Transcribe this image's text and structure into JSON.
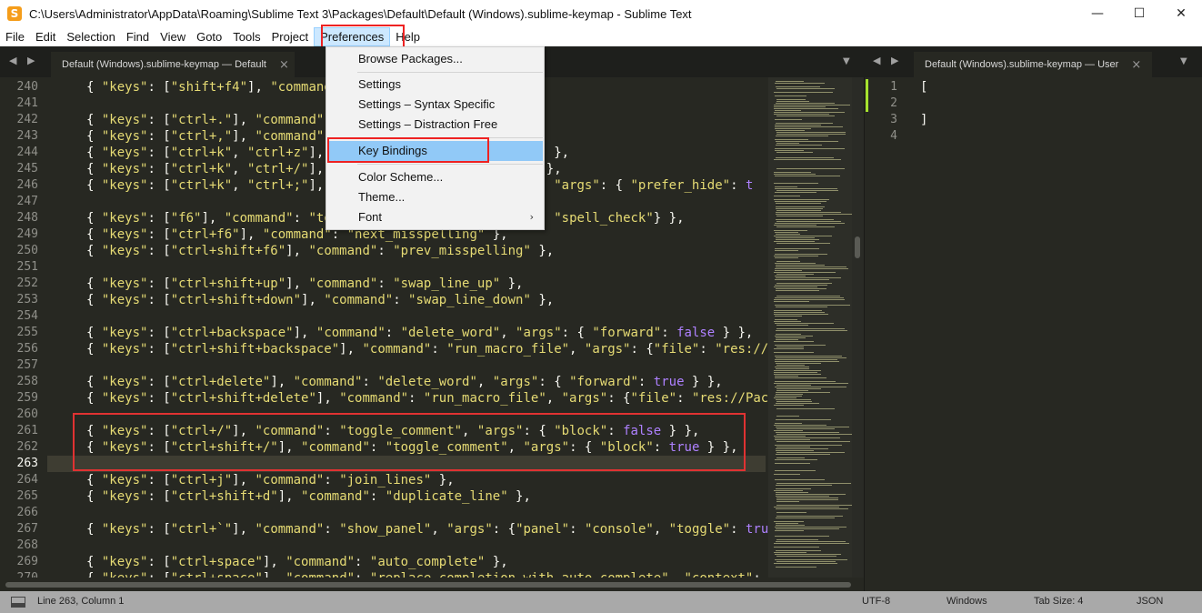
{
  "window": {
    "title": "C:\\Users\\Administrator\\AppData\\Roaming\\Sublime Text 3\\Packages\\Default\\Default (Windows).sublime-keymap - Sublime Text",
    "icon": "sublime-logo-icon",
    "minimize_glyph": "—",
    "maximize_glyph": "☐",
    "close_glyph": "✕"
  },
  "menubar": {
    "items": [
      "File",
      "Edit",
      "Selection",
      "Find",
      "View",
      "Goto",
      "Tools",
      "Project",
      "Preferences",
      "Help"
    ],
    "active": "Preferences"
  },
  "preferences_menu": {
    "items": [
      {
        "label": "Browse Packages..."
      },
      {
        "label": "Settings"
      },
      {
        "label": "Settings – Syntax Specific"
      },
      {
        "label": "Settings – Distraction Free"
      },
      {
        "label": "Key Bindings",
        "highlighted": true
      },
      {
        "label": "Color Scheme..."
      },
      {
        "label": "Theme..."
      },
      {
        "label": "Font",
        "submenu_arrow": "›"
      }
    ]
  },
  "tabs": {
    "left": {
      "label": "Default (Windows).sublime-keymap — Default",
      "close": "×",
      "nav": "◀ ▶",
      "dropdown": "▼"
    },
    "right": {
      "label": "Default (Windows).sublime-keymap — User",
      "close": "×",
      "nav": "◀ ▶",
      "dropdown": "▼"
    }
  },
  "editor_left": {
    "lines": [
      {
        "n": "240",
        "code": "{ \"keys\": [\"shift+f4\"], \"command\"",
        "html": "{ <span class=\"s\">\"keys\"</span>: [<span class=\"s\">\"shift+f4\"</span>], <span class=\"s\">\"command\"</span>"
      },
      {
        "n": "241",
        "code": ""
      },
      {
        "n": "242",
        "code": "{ \"keys\": [\"ctrl+.\"], \"command\":",
        "html": "{ <span class=\"s\">\"keys\"</span>: [<span class=\"s\">\"ctrl+.\"</span>], <span class=\"s\">\"command\"</span>:"
      },
      {
        "n": "243",
        "code": "{ \"keys\": [\"ctrl+,\"], \"command\":",
        "html": "{ <span class=\"s\">\"keys\"</span>: [<span class=\"s\">\"ctrl+,\"</span>], <span class=\"s\">\"command\"</span>:"
      },
      {
        "n": "244",
        "code": "{ \"keys\": [\"ctrl+k\", \"ctrl+z\"],                          on\" },",
        "html": "{ <span class=\"s\">\"keys\"</span>: [<span class=\"s\">\"ctrl+k\"</span>, <span class=\"s\">\"ctrl+z\"</span>],                          <span class=\"s\">on\"</span> },"
      },
      {
        "n": "245",
        "code": "{ \"keys\": [\"ctrl+k\", \"ctrl+/\"],                          f\" },",
        "html": "{ <span class=\"s\">\"keys\"</span>: [<span class=\"s\">\"ctrl+k\"</span>, <span class=\"s\">\"ctrl+/\"</span>],                          <span class=\"s\">f\"</span> },"
      },
      {
        "n": "246",
        "code": "{ \"keys\": [\"ctrl+k\", \"ctrl+;\"],                          f\", \"args\": { \"prefer_hide\": t",
        "html": "{ <span class=\"s\">\"keys\"</span>: [<span class=\"s\">\"ctrl+k\"</span>, <span class=\"s\">\"ctrl+;\"</span>],                          <span class=\"s\">f\"</span>, <span class=\"s\">\"args\"</span>: { <span class=\"s\">\"prefer_hide\"</span>: <span class=\"k\">t</span>"
      },
      {
        "n": "247",
        "code": ""
      },
      {
        "n": "248",
        "code": "{ \"keys\": [\"f6\"], \"command\": \"to                       ing\": \"spell_check\"} },",
        "html": "{ <span class=\"s\">\"keys\"</span>: [<span class=\"s\">\"f6\"</span>], <span class=\"s\">\"command\"</span>: <span class=\"s\">\"to</span>                       <span class=\"s\">ing\"</span>: <span class=\"s\">\"spell_check\"</span>} },"
      },
      {
        "n": "249",
        "code": "{ \"keys\": [\"ctrl+f6\"], \"command\": \"next_misspelling\" },",
        "html": "{ <span class=\"s\">\"keys\"</span>: [<span class=\"s\">\"ctrl+f6\"</span>], <span class=\"s\">\"command\"</span>: <span class=\"s\">\"next_misspelling\"</span> },"
      },
      {
        "n": "250",
        "code": "{ \"keys\": [\"ctrl+shift+f6\"], \"command\": \"prev_misspelling\" },",
        "html": "{ <span class=\"s\">\"keys\"</span>: [<span class=\"s\">\"ctrl+shift+f6\"</span>], <span class=\"s\">\"command\"</span>: <span class=\"s\">\"prev_misspelling\"</span> },"
      },
      {
        "n": "251",
        "code": ""
      },
      {
        "n": "252",
        "code": "{ \"keys\": [\"ctrl+shift+up\"], \"command\": \"swap_line_up\" },",
        "html": "{ <span class=\"s\">\"keys\"</span>: [<span class=\"s\">\"ctrl+shift+up\"</span>], <span class=\"s\">\"command\"</span>: <span class=\"s\">\"swap_line_up\"</span> },"
      },
      {
        "n": "253",
        "code": "{ \"keys\": [\"ctrl+shift+down\"], \"command\": \"swap_line_down\" },",
        "html": "{ <span class=\"s\">\"keys\"</span>: [<span class=\"s\">\"ctrl+shift+down\"</span>], <span class=\"s\">\"command\"</span>: <span class=\"s\">\"swap_line_down\"</span> },"
      },
      {
        "n": "254",
        "code": ""
      },
      {
        "n": "255",
        "code": "{ \"keys\": [\"ctrl+backspace\"], \"command\": \"delete_word\", \"args\": { \"forward\": false } },",
        "html": "{ <span class=\"s\">\"keys\"</span>: [<span class=\"s\">\"ctrl+backspace\"</span>], <span class=\"s\">\"command\"</span>: <span class=\"s\">\"delete_word\"</span>, <span class=\"s\">\"args\"</span>: { <span class=\"s\">\"forward\"</span>: <span class=\"k\">false</span> } },"
      },
      {
        "n": "256",
        "code": "{ \"keys\": [\"ctrl+shift+backspace\"], \"command\": \"run_macro_file\", \"args\": {\"file\": \"res://Pa",
        "html": "{ <span class=\"s\">\"keys\"</span>: [<span class=\"s\">\"ctrl+shift+backspace\"</span>], <span class=\"s\">\"command\"</span>: <span class=\"s\">\"run_macro_file\"</span>, <span class=\"s\">\"args\"</span>: {<span class=\"s\">\"file\"</span>: <span class=\"s\">\"res://Pa</span>"
      },
      {
        "n": "257",
        "code": ""
      },
      {
        "n": "258",
        "code": "{ \"keys\": [\"ctrl+delete\"], \"command\": \"delete_word\", \"args\": { \"forward\": true } },",
        "html": "{ <span class=\"s\">\"keys\"</span>: [<span class=\"s\">\"ctrl+delete\"</span>], <span class=\"s\">\"command\"</span>: <span class=\"s\">\"delete_word\"</span>, <span class=\"s\">\"args\"</span>: { <span class=\"s\">\"forward\"</span>: <span class=\"k\">true</span> } },"
      },
      {
        "n": "259",
        "code": "{ \"keys\": [\"ctrl+shift+delete\"], \"command\": \"run_macro_file\", \"args\": {\"file\": \"res://Packa",
        "html": "{ <span class=\"s\">\"keys\"</span>: [<span class=\"s\">\"ctrl+shift+delete\"</span>], <span class=\"s\">\"command\"</span>: <span class=\"s\">\"run_macro_file\"</span>, <span class=\"s\">\"args\"</span>: {<span class=\"s\">\"file\"</span>: <span class=\"s\">\"res://Packa</span>"
      },
      {
        "n": "260",
        "code": ""
      },
      {
        "n": "261",
        "code": "{ \"keys\": [\"ctrl+/\"], \"command\": \"toggle_comment\", \"args\": { \"block\": false } },",
        "html": "{ <span class=\"s\">\"keys\"</span>: [<span class=\"s\">\"ctrl+/\"</span>], <span class=\"s\">\"command\"</span>: <span class=\"s\">\"toggle_comment\"</span>, <span class=\"s\">\"args\"</span>: { <span class=\"s\">\"block\"</span>: <span class=\"k\">false</span> } },"
      },
      {
        "n": "262",
        "code": "{ \"keys\": [\"ctrl+shift+/\"], \"command\": \"toggle_comment\", \"args\": { \"block\": true } },",
        "html": "{ <span class=\"s\">\"keys\"</span>: [<span class=\"s\">\"ctrl+shift+/\"</span>], <span class=\"s\">\"command\"</span>: <span class=\"s\">\"toggle_comment\"</span>, <span class=\"s\">\"args\"</span>: { <span class=\"s\">\"block\"</span>: <span class=\"k\">true</span> } },"
      },
      {
        "n": "263",
        "code": ""
      },
      {
        "n": "264",
        "code": "{ \"keys\": [\"ctrl+j\"], \"command\": \"join_lines\" },",
        "html": "{ <span class=\"s\">\"keys\"</span>: [<span class=\"s\">\"ctrl+j\"</span>], <span class=\"s\">\"command\"</span>: <span class=\"s\">\"join_lines\"</span> },"
      },
      {
        "n": "265",
        "code": "{ \"keys\": [\"ctrl+shift+d\"], \"command\": \"duplicate_line\" },",
        "html": "{ <span class=\"s\">\"keys\"</span>: [<span class=\"s\">\"ctrl+shift+d\"</span>], <span class=\"s\">\"command\"</span>: <span class=\"s\">\"duplicate_line\"</span> },"
      },
      {
        "n": "266",
        "code": ""
      },
      {
        "n": "267",
        "code": "{ \"keys\": [\"ctrl+`\"], \"command\": \"show_panel\", \"args\": {\"panel\": \"console\", \"toggle\": true}",
        "html": "{ <span class=\"s\">\"keys\"</span>: [<span class=\"s\">\"ctrl+`\"</span>], <span class=\"s\">\"command\"</span>: <span class=\"s\">\"show_panel\"</span>, <span class=\"s\">\"args\"</span>: {<span class=\"s\">\"panel\"</span>: <span class=\"s\">\"console\"</span>, <span class=\"s\">\"toggle\"</span>: <span class=\"k\">true</span>}"
      },
      {
        "n": "268",
        "code": ""
      },
      {
        "n": "269",
        "code": "{ \"keys\": [\"ctrl+space\"], \"command\": \"auto_complete\" },",
        "html": "{ <span class=\"s\">\"keys\"</span>: [<span class=\"s\">\"ctrl+space\"</span>], <span class=\"s\">\"command\"</span>: <span class=\"s\">\"auto_complete\"</span> },"
      },
      {
        "n": "270",
        "code": "{ \"keys\": [\"ctrl+space\"], \"command\": \"replace_completion_with_auto_complete\", \"context\":",
        "html": "{ <span class=\"s\">\"keys\"</span>: [<span class=\"s\">\"ctrl+space\"</span>], <span class=\"s\">\"command\"</span>: <span class=\"s\">\"replace_completion_with_auto_complete\"</span>, <span class=\"s\">\"context\"</span>:"
      }
    ],
    "current_line": "263"
  },
  "editor_right": {
    "lines": [
      {
        "n": "1",
        "code": "["
      },
      {
        "n": "2",
        "code": ""
      },
      {
        "n": "3",
        "code": "]"
      },
      {
        "n": "4",
        "code": ""
      }
    ]
  },
  "statusbar": {
    "position": "Line 263, Column 1",
    "encoding": "UTF-8",
    "line_endings": "Windows",
    "tab_size": "Tab Size: 4",
    "syntax": "JSON"
  },
  "colors": {
    "editor_bg": "#272822",
    "string": "#e6db74",
    "constant": "#ae81ff",
    "highlight_outline": "#e22222",
    "menu_highlight": "#91c9f7"
  }
}
